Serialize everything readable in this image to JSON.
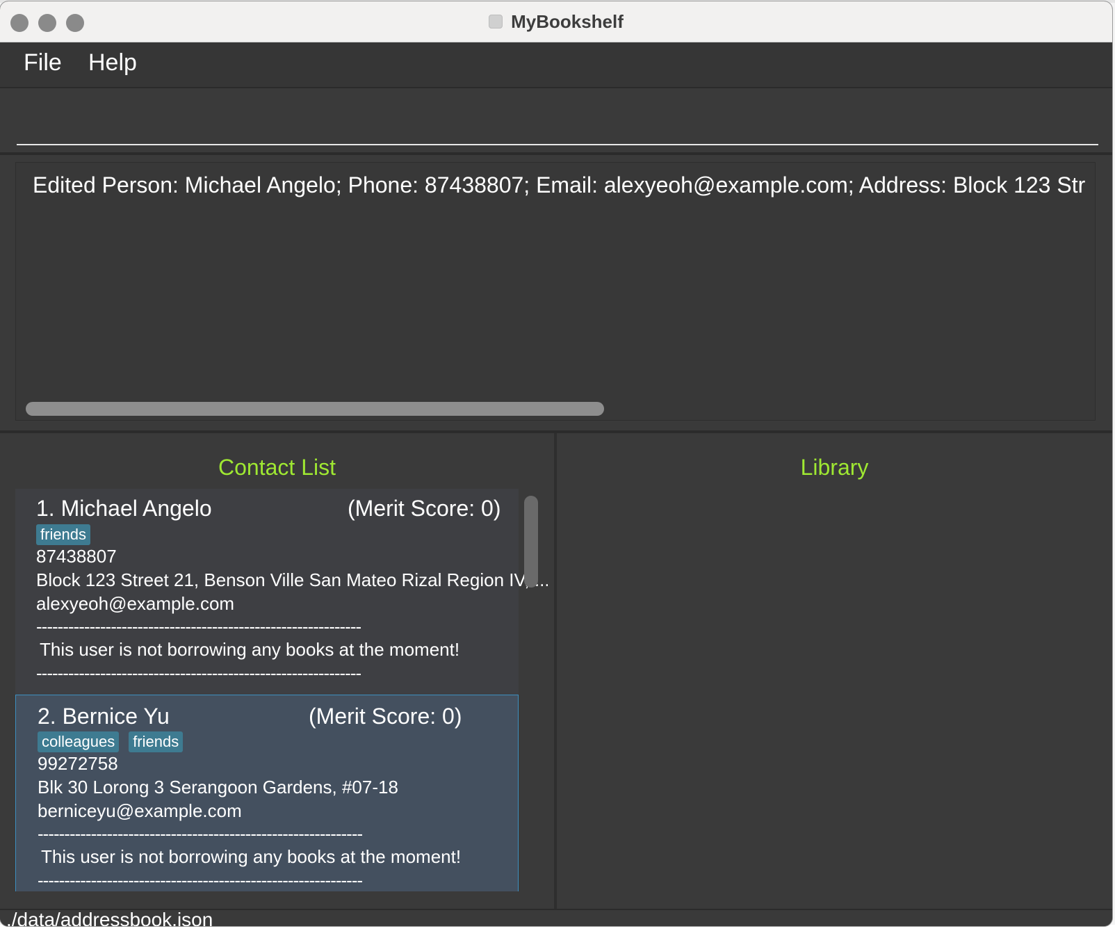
{
  "window": {
    "title": "MyBookshelf"
  },
  "menu": {
    "file": "File",
    "help": "Help"
  },
  "command": {
    "value": "",
    "placeholder": ""
  },
  "result": {
    "text": "Edited Person: Michael Angelo; Phone: 87438807; Email: alexyeoh@example.com; Address: Block 123 Str"
  },
  "panes": {
    "contacts_title": "Contact List",
    "library_title": "Library"
  },
  "contacts": [
    {
      "name_line": "1.  Michael Angelo",
      "merit": "(Merit Score: 0)",
      "tags": [
        "friends"
      ],
      "phone": "87438807",
      "address": "Block 123 Street 21, Benson Ville San Mateo Rizal Region IV, ...",
      "email": "alexyeoh@example.com",
      "divider": "-------------------------------------------------------------",
      "borrow_status": "This user is not borrowing any books at the moment!"
    },
    {
      "name_line": "2.  Bernice Yu",
      "merit": "(Merit Score: 0)",
      "tags": [
        "colleagues",
        "friends"
      ],
      "phone": "99272758",
      "address": "Blk 30 Lorong 3 Serangoon Gardens, #07-18",
      "email": "berniceyu@example.com",
      "divider": "-------------------------------------------------------------",
      "borrow_status": "This user is not borrowing any books at the moment!"
    }
  ],
  "status": {
    "path": "./data/addressbook.json"
  },
  "colors": {
    "background": "#3a3a3a",
    "pane_title": "#9fe832",
    "tag": "#3e7b91",
    "selected_card": "#44505f",
    "selected_border": "#3d8fbf"
  }
}
